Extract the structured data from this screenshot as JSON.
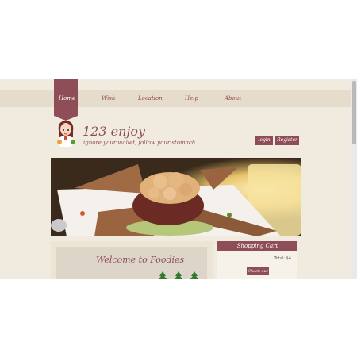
{
  "nav": {
    "items": [
      {
        "label": "Home",
        "active": true
      },
      {
        "label": "Wish",
        "active": false
      },
      {
        "label": "Location",
        "active": false
      },
      {
        "label": "Help",
        "active": false
      },
      {
        "label": "About",
        "active": false
      }
    ]
  },
  "header": {
    "title": "123 enjoy",
    "tagline": "ignore your wallet, follow your stomach",
    "buttons": {
      "login": "login",
      "register": "Register"
    }
  },
  "welcome": {
    "title": "Welcome to Foodies"
  },
  "cart": {
    "title": "Shopping Cart",
    "total": "Total: $4",
    "checkout": "Check out"
  },
  "colors": {
    "accent": "#8e4e57",
    "page_bg": "#f1ebdf",
    "nav_band": "#e6dccb",
    "panel_bg": "#ece5d6"
  }
}
